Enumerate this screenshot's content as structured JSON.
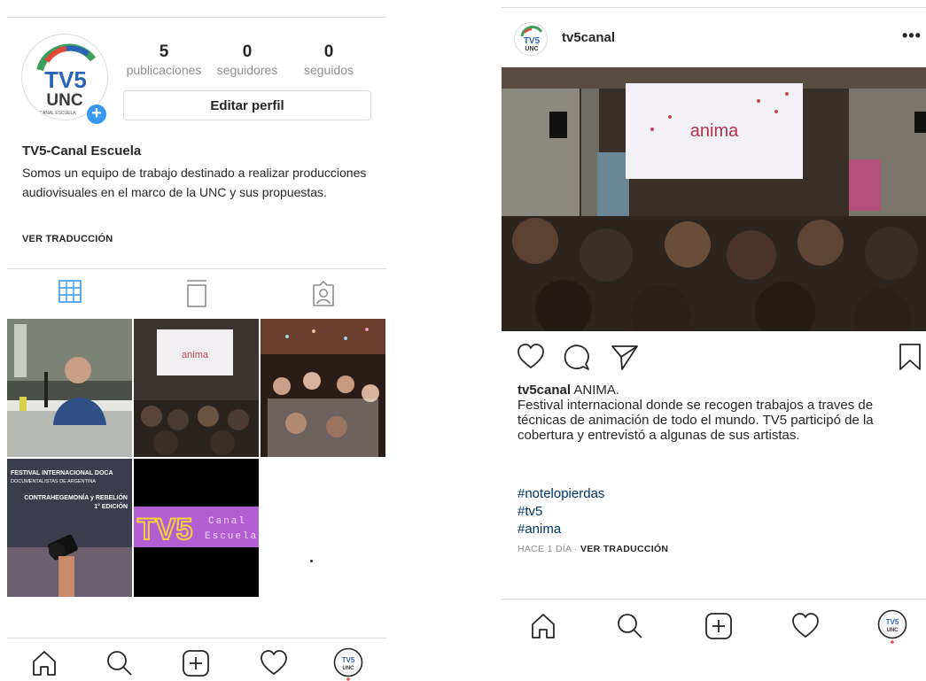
{
  "profile": {
    "stats": [
      {
        "value": "5",
        "label": "publicaciones"
      },
      {
        "value": "0",
        "label": "seguidores"
      },
      {
        "value": "0",
        "label": "seguidos"
      }
    ],
    "edit_button_label": "Editar perfil",
    "name": "TV5-Canal Escuela",
    "bio": "Somos un equipo de trabajo destinado a realizar producciones audiovisuales en el marco de la UNC y sus propuestas.",
    "see_translation": "VER TRADUCCIÓN",
    "logo": {
      "line1": "TV5",
      "line2": "UNC",
      "tagline": "CANAL ESCUELA"
    },
    "tabs": [
      "grid-icon",
      "igtv-icon",
      "tagged-icon"
    ],
    "grid_posts": [
      {
        "kind": "photo",
        "caption": ""
      },
      {
        "kind": "photo",
        "caption": "anima"
      },
      {
        "kind": "photo",
        "caption": ""
      },
      {
        "kind": "poster",
        "line1": "FESTIVAL INTERNACIONAL DOCA",
        "line2": "DOCUMENTALISTAS DE ARGENTINA",
        "line3": "CONTRAHEGEMONÍA y REBELIÓN",
        "line4": "1° EDICIÓN"
      },
      {
        "kind": "logo",
        "big": "TV5",
        "small1": "Canal",
        "small2": "Escuela"
      }
    ]
  },
  "post": {
    "username": "tv5canal",
    "more_icon": "•••",
    "photo_screen_text": "anima",
    "caption_user": "tv5canal",
    "caption_text": " ANIMA.\nFestival internacional donde se recogen trabajos a traves de técnicas de animación de todo el mundo. TV5 participó de la cobertura y entrevistó a algunas de sus artistas.",
    "hashtags": [
      "#notelopierdas",
      "#tv5",
      "#anima"
    ],
    "time": "HACE 1 DÍA",
    "separator": "·",
    "see_translation": "VER TRADUCCIÓN"
  },
  "bottom_nav": [
    "home-icon",
    "search-icon",
    "new-post-icon",
    "activity-heart-icon",
    "profile-avatar-icon"
  ],
  "colors": {
    "accent_blue": "#3897f0",
    "border": "#dbdbdb",
    "muted": "#8e8e8e",
    "hashtag": "#003569",
    "tv5_purple": "#b35fd3"
  }
}
